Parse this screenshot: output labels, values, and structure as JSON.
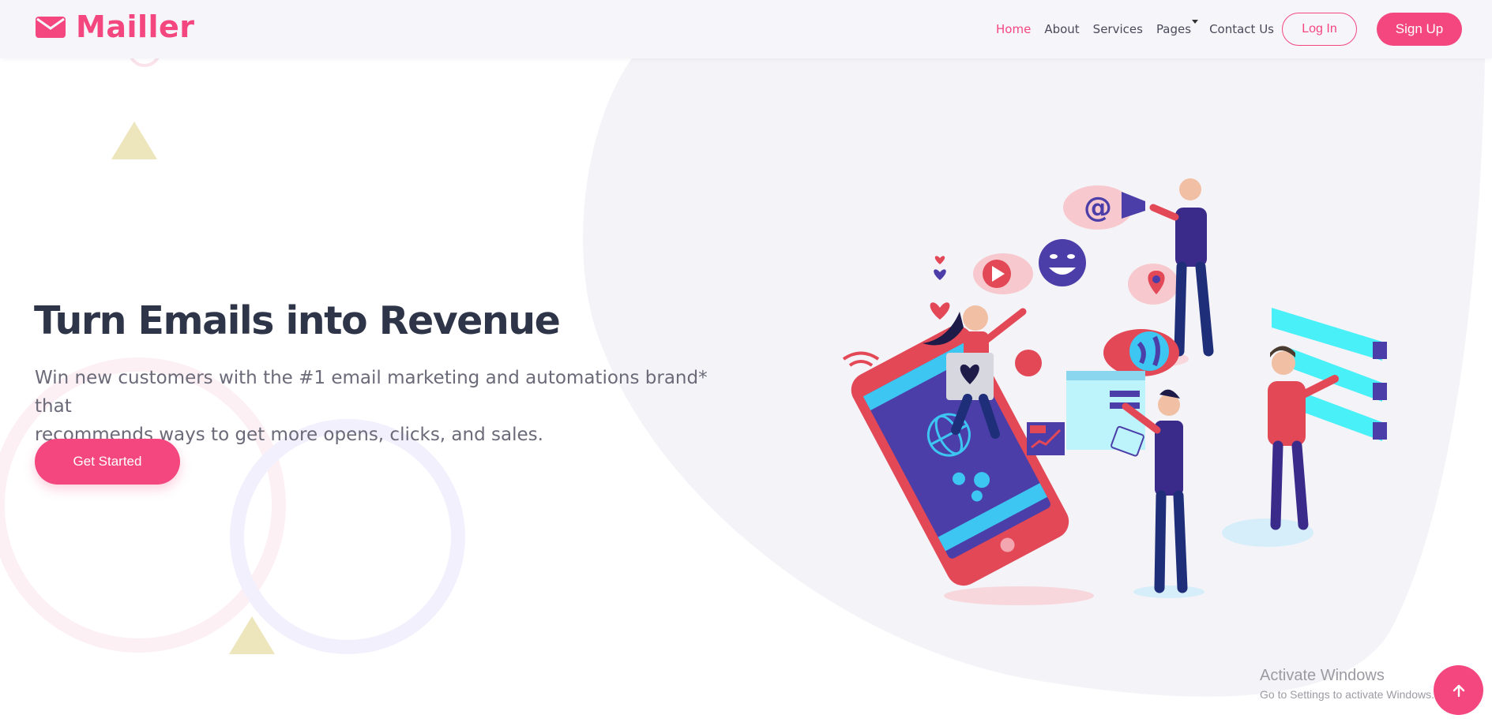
{
  "brand": {
    "name": "Mailler",
    "icon": "envelope-icon",
    "color": "#f4467f"
  },
  "nav": {
    "items": [
      {
        "label": "Home",
        "active": true
      },
      {
        "label": "About",
        "active": false
      },
      {
        "label": "Services",
        "active": false
      },
      {
        "label": "Pages",
        "active": false,
        "has_dropdown": true
      },
      {
        "label": "Contact Us",
        "active": false
      }
    ],
    "login_label": "Log In",
    "signup_label": "Sign Up"
  },
  "hero": {
    "title": "Turn Emails into Revenue",
    "subtitle_line1": "Win new customers with the #1 email marketing and automations brand* that",
    "subtitle_line2": "recommends ways to get more opens, clicks, and sales.",
    "cta_label": "Get Started"
  },
  "watermark": {
    "title": "Activate Windows",
    "subtitle": "Go to Settings to activate Windows."
  },
  "back_to_top": {
    "icon": "arrow-up-icon"
  },
  "colors": {
    "accent": "#f4467f",
    "heading": "#2f3548",
    "body_text": "#6a6a78",
    "blob": "#f4f3f8",
    "triangle": "#ede5bb",
    "circle_pink": "#fdf0f4",
    "circle_lavender": "#f3f0fd"
  }
}
